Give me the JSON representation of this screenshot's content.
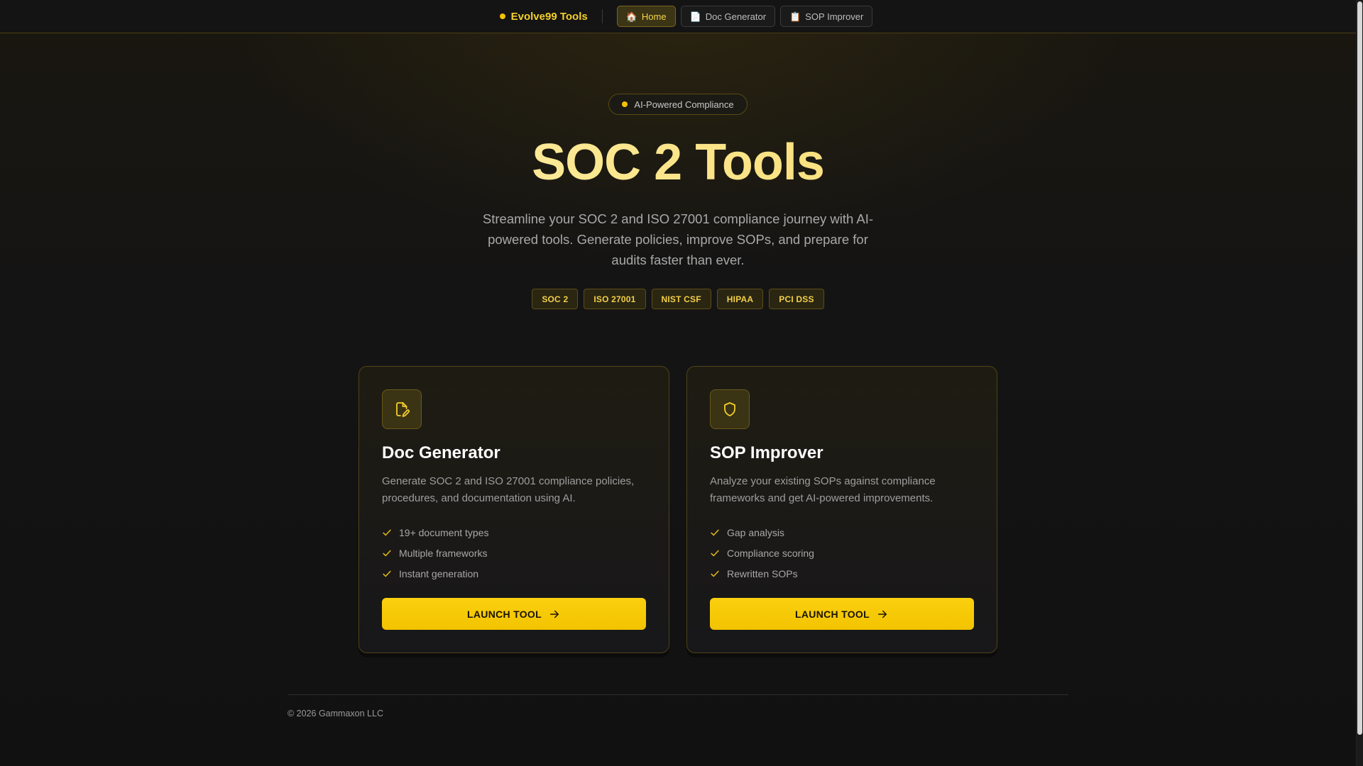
{
  "nav": {
    "brand": "Evolve99 Tools",
    "items": [
      {
        "icon": "🏠",
        "label": "Home",
        "active": true
      },
      {
        "icon": "📄",
        "label": "Doc Generator",
        "active": false
      },
      {
        "icon": "📋",
        "label": "SOP Improver",
        "active": false
      }
    ]
  },
  "hero": {
    "badge": "AI-Powered Compliance",
    "title": "SOC 2 Tools",
    "subtitle": "Streamline your SOC 2 and ISO 27001 compliance journey with AI-powered tools. Generate policies, improve SOPs, and prepare for audits faster than ever.",
    "tags": [
      "SOC 2",
      "ISO 27001",
      "NIST CSF",
      "HIPAA",
      "PCI DSS"
    ]
  },
  "cards": [
    {
      "icon": "document-edit-icon",
      "title": "Doc Generator",
      "description": "Generate SOC 2 and ISO 27001 compliance policies, procedures, and documentation using AI.",
      "features": [
        "19+ document types",
        "Multiple frameworks",
        "Instant generation"
      ],
      "button": "LAUNCH TOOL"
    },
    {
      "icon": "shield-icon",
      "title": "SOP Improver",
      "description": "Analyze your existing SOPs against compliance frameworks and get AI-powered improvements.",
      "features": [
        "Gap analysis",
        "Compliance scoring",
        "Rewritten SOPs"
      ],
      "button": "LAUNCH TOOL"
    }
  ],
  "footer": {
    "copyright": "© 2026 Gammaxon LLC"
  },
  "colors": {
    "accent": "#f2c200",
    "accent_text": "#f5cf2a",
    "background": "#131313"
  }
}
